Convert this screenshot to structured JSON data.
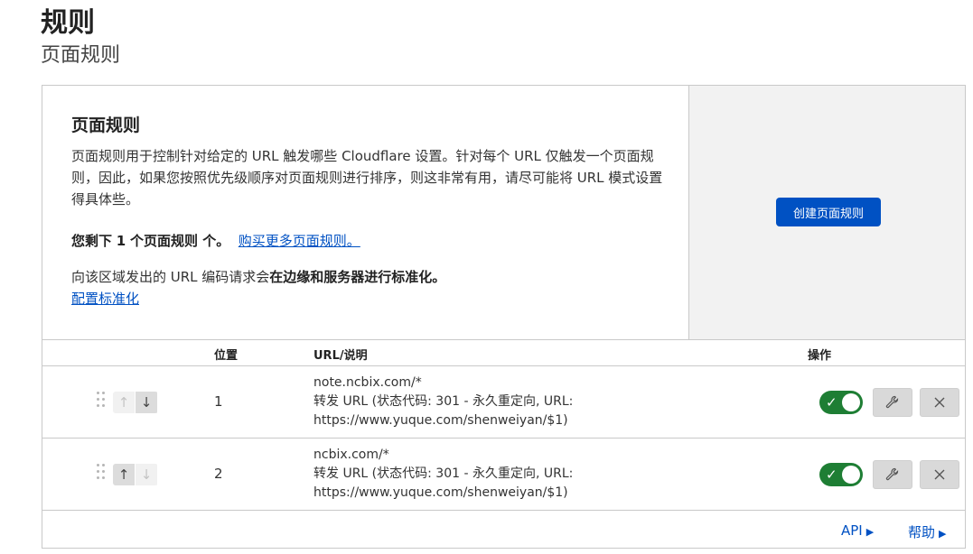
{
  "header": {
    "title": "规则",
    "subtitle": "页面规则"
  },
  "intro": {
    "heading": "页面规则",
    "description": "页面规则用于控制针对给定的 URL 触发哪些 Cloudflare 设置。针对每个 URL 仅触发一个页面规则，因此，如果您按照优先级顺序对页面规则进行排序，则这非常有用，请尽可能将 URL 模式设置得具体些。",
    "remaining_prefix": "您剩下",
    "remaining_count": "1",
    "remaining_suffix": "个页面规则 个。",
    "buy_more_link": "购买更多页面规则。",
    "normalize_prefix": "向该区域发出的 URL 编码请求会",
    "normalize_bold": "在边缘和服务器进行标准化。",
    "normalize_link": "配置标准化"
  },
  "aside": {
    "create_button": "创建页面规则"
  },
  "table": {
    "headers": {
      "position": "位置",
      "url": "URL/说明",
      "actions": "操作"
    },
    "rows": [
      {
        "position": "1",
        "url": "note.ncbix.com/*",
        "desc_line1": "转发 URL (状态代码: 301 - 永久重定向, URL:",
        "desc_line2": "https://www.yuque.com/shenweiyan/$1)",
        "enabled": true
      },
      {
        "position": "2",
        "url": "ncbix.com/*",
        "desc_line1": "转发 URL (状态代码: 301 - 永久重定向, URL:",
        "desc_line2": "https://www.yuque.com/shenweiyan/$1)",
        "enabled": true
      }
    ]
  },
  "footer": {
    "api_link": "API",
    "help_link": "帮助"
  },
  "colors": {
    "primary": "#0051c3",
    "toggle_on": "#1e7e34",
    "aside_bg": "#f2f2f2"
  },
  "icons": {
    "drag": "drag-handle-icon",
    "up": "arrow-up-icon",
    "down": "arrow-down-icon",
    "edit": "wrench-icon",
    "delete": "close-icon",
    "toggle": "check-icon"
  }
}
